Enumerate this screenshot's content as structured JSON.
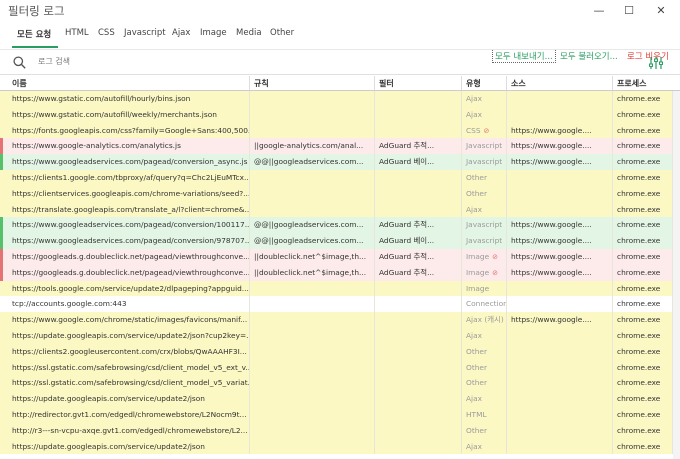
{
  "window": {
    "title": "필터링 로그",
    "minimize_glyph": "—",
    "maximize_glyph": "☐",
    "close_glyph": "✕"
  },
  "tabs": [
    {
      "label": "모든 요청",
      "active": true
    },
    {
      "label": "HTML",
      "active": false
    },
    {
      "label": "CSS",
      "active": false
    },
    {
      "label": "Javascript",
      "active": false
    },
    {
      "label": "Ajax",
      "active": false
    },
    {
      "label": "Image",
      "active": false
    },
    {
      "label": "Media",
      "active": false
    },
    {
      "label": "Other",
      "active": false
    }
  ],
  "actions": {
    "export_label": "모두 내보내기...",
    "import_label": "모두 불러오기...",
    "clear_label": "로그 비우기"
  },
  "colors": {
    "accent": "#2a9d62",
    "danger": "#e0443c",
    "row_yellow": "#fbf8c4",
    "row_green": "#e3f5e4",
    "row_pink": "#fcebea"
  },
  "search": {
    "placeholder": "로그 검색",
    "icon": "search-icon",
    "filter_icon": "filter-sliders-icon"
  },
  "columns": {
    "name": "이름",
    "rule": "규칙",
    "filter": "필터",
    "type": "유형",
    "source": "소스",
    "process": "프로세스"
  },
  "rows": [
    {
      "name": "https://www.gstatic.com/autofill/hourly/bins.json",
      "rule": "",
      "filter": "",
      "type": "Ajax",
      "source": "",
      "process": "chrome.exe",
      "status": "yellow",
      "link_icon": false
    },
    {
      "name": "https://www.gstatic.com/autofill/weekly/merchants.json",
      "rule": "",
      "filter": "",
      "type": "Ajax",
      "source": "",
      "process": "chrome.exe",
      "status": "yellow",
      "link_icon": false
    },
    {
      "name": "https://fonts.googleapis.com/css?family=Google+Sans:400,500...",
      "rule": "",
      "filter": "",
      "type": "CSS",
      "source": "https://www.google....",
      "process": "chrome.exe",
      "status": "yellow",
      "link_icon": true
    },
    {
      "name": "https://www.google-analytics.com/analytics.js",
      "rule": "||google-analytics.com/anal...",
      "filter": "AdGuard 추적...",
      "type": "Javascript",
      "source": "https://www.google....",
      "process": "chrome.exe",
      "status": "pink",
      "link_icon": false
    },
    {
      "name": "https://www.googleadservices.com/pagead/conversion_async.js",
      "rule": "@@||googleadservices.com...",
      "filter": "AdGuard 베이...",
      "type": "Javascript",
      "source": "https://www.google....",
      "process": "chrome.exe",
      "status": "green",
      "link_icon": false
    },
    {
      "name": "https://clients1.google.com/tbproxy/af/query?q=Chc2LjEuMTcx...",
      "rule": "",
      "filter": "",
      "type": "Other",
      "source": "",
      "process": "chrome.exe",
      "status": "yellow",
      "link_icon": false
    },
    {
      "name": "https://clientservices.googleapis.com/chrome-variations/seed?...",
      "rule": "",
      "filter": "",
      "type": "Other",
      "source": "",
      "process": "chrome.exe",
      "status": "yellow",
      "link_icon": false
    },
    {
      "name": "https://translate.googleapis.com/translate_a/l?client=chrome&...",
      "rule": "",
      "filter": "",
      "type": "Ajax",
      "source": "",
      "process": "chrome.exe",
      "status": "yellow",
      "link_icon": false
    },
    {
      "name": "https://www.googleadservices.com/pagead/conversion/100117...",
      "rule": "@@||googleadservices.com...",
      "filter": "AdGuard 추적...",
      "type": "Javascript",
      "source": "https://www.google....",
      "process": "chrome.exe",
      "status": "green",
      "link_icon": false
    },
    {
      "name": "https://www.googleadservices.com/pagead/conversion/978707...",
      "rule": "@@||googleadservices.com...",
      "filter": "AdGuard 베이...",
      "type": "Javascript",
      "source": "https://www.google....",
      "process": "chrome.exe",
      "status": "green",
      "link_icon": false
    },
    {
      "name": "https://googleads.g.doubleclick.net/pagead/viewthroughconve...",
      "rule": "||doubleclick.net^$image,th...",
      "filter": "AdGuard 추적...",
      "type": "Image",
      "source": "https://www.google....",
      "process": "chrome.exe",
      "status": "pink",
      "link_icon": true
    },
    {
      "name": "https://googleads.g.doubleclick.net/pagead/viewthroughconve...",
      "rule": "||doubleclick.net^$image,th...",
      "filter": "AdGuard 추적...",
      "type": "Image",
      "source": "https://www.google....",
      "process": "chrome.exe",
      "status": "pink",
      "link_icon": true
    },
    {
      "name": "https://tools.google.com/service/update2/dlpageping?appguid...",
      "rule": "",
      "filter": "",
      "type": "Image",
      "source": "",
      "process": "chrome.exe",
      "status": "yellow",
      "link_icon": false
    },
    {
      "name": "tcp://accounts.google.com:443",
      "rule": "",
      "filter": "",
      "type": "Connection",
      "source": "",
      "process": "chrome.exe",
      "status": "white",
      "link_icon": false
    },
    {
      "name": "https://www.google.com/chrome/static/images/favicons/manif...",
      "rule": "",
      "filter": "",
      "type": "Ajax (캐시)",
      "source": "https://www.google....",
      "process": "chrome.exe",
      "status": "yellow",
      "link_icon": false
    },
    {
      "name": "https://update.googleapis.com/service/update2/json?cup2key=...",
      "rule": "",
      "filter": "",
      "type": "Ajax",
      "source": "",
      "process": "chrome.exe",
      "status": "yellow",
      "link_icon": false
    },
    {
      "name": "https://clients2.googleusercontent.com/crx/blobs/QwAAAHF3I...",
      "rule": "",
      "filter": "",
      "type": "Other",
      "source": "",
      "process": "chrome.exe",
      "status": "yellow",
      "link_icon": false
    },
    {
      "name": "https://ssl.gstatic.com/safebrowsing/csd/client_model_v5_ext_v...",
      "rule": "",
      "filter": "",
      "type": "Other",
      "source": "",
      "process": "chrome.exe",
      "status": "yellow",
      "link_icon": false
    },
    {
      "name": "https://ssl.gstatic.com/safebrowsing/csd/client_model_v5_variat...",
      "rule": "",
      "filter": "",
      "type": "Other",
      "source": "",
      "process": "chrome.exe",
      "status": "yellow",
      "link_icon": false
    },
    {
      "name": "https://update.googleapis.com/service/update2/json",
      "rule": "",
      "filter": "",
      "type": "Ajax",
      "source": "",
      "process": "chrome.exe",
      "status": "yellow",
      "link_icon": false
    },
    {
      "name": "http://redirector.gvt1.com/edgedl/chromewebstore/L2Nocm9t...",
      "rule": "",
      "filter": "",
      "type": "HTML",
      "source": "",
      "process": "chrome.exe",
      "status": "yellow",
      "link_icon": false
    },
    {
      "name": "http://r3---sn-vcpu-axqe.gvt1.com/edgedl/chromewebstore/L2...",
      "rule": "",
      "filter": "",
      "type": "Other",
      "source": "",
      "process": "chrome.exe",
      "status": "yellow",
      "link_icon": false
    },
    {
      "name": "https://update.googleapis.com/service/update2/json",
      "rule": "",
      "filter": "",
      "type": "Ajax",
      "source": "",
      "process": "chrome.exe",
      "status": "yellow",
      "link_icon": false
    }
  ]
}
